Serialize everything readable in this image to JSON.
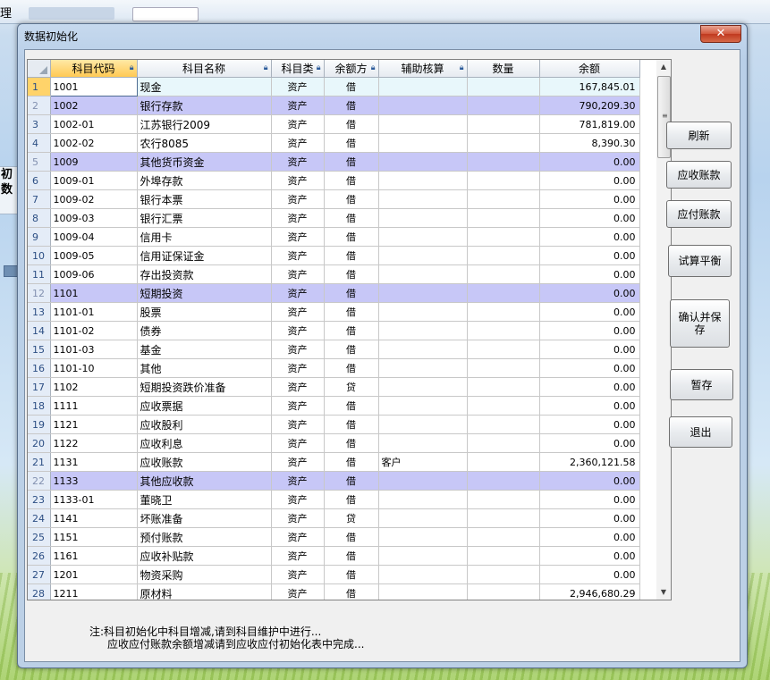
{
  "background": {
    "menu_label": "理",
    "side_label_1": "初",
    "side_label_2": "数"
  },
  "dialog": {
    "title": "数据初始化",
    "close_icon": "close-icon"
  },
  "grid": {
    "columns": [
      "科目代码",
      "科目名称",
      "科目类",
      "余额方",
      "辅助核算",
      "数量",
      "余额"
    ],
    "rows": [
      {
        "num": "1",
        "code": "1001",
        "name": "现金",
        "type": "资产",
        "dir": "借",
        "aux": "",
        "qty": "",
        "bal": "167,845.01",
        "hl": false
      },
      {
        "num": "2",
        "code": "1002",
        "name": "银行存款",
        "type": "资产",
        "dir": "借",
        "aux": "",
        "qty": "",
        "bal": "790,209.30",
        "hl": true
      },
      {
        "num": "3",
        "code": "1002-01",
        "name": "江苏银行2009",
        "type": "资产",
        "dir": "借",
        "aux": "",
        "qty": "",
        "bal": "781,819.00",
        "hl": false
      },
      {
        "num": "4",
        "code": "1002-02",
        "name": "农行8085",
        "type": "资产",
        "dir": "借",
        "aux": "",
        "qty": "",
        "bal": "8,390.30",
        "hl": false
      },
      {
        "num": "5",
        "code": "1009",
        "name": "其他货币资金",
        "type": "资产",
        "dir": "借",
        "aux": "",
        "qty": "",
        "bal": "0.00",
        "hl": true
      },
      {
        "num": "6",
        "code": "1009-01",
        "name": "外埠存款",
        "type": "资产",
        "dir": "借",
        "aux": "",
        "qty": "",
        "bal": "0.00",
        "hl": false
      },
      {
        "num": "7",
        "code": "1009-02",
        "name": "银行本票",
        "type": "资产",
        "dir": "借",
        "aux": "",
        "qty": "",
        "bal": "0.00",
        "hl": false
      },
      {
        "num": "8",
        "code": "1009-03",
        "name": "银行汇票",
        "type": "资产",
        "dir": "借",
        "aux": "",
        "qty": "",
        "bal": "0.00",
        "hl": false
      },
      {
        "num": "9",
        "code": "1009-04",
        "name": "信用卡",
        "type": "资产",
        "dir": "借",
        "aux": "",
        "qty": "",
        "bal": "0.00",
        "hl": false
      },
      {
        "num": "10",
        "code": "1009-05",
        "name": "信用证保证金",
        "type": "资产",
        "dir": "借",
        "aux": "",
        "qty": "",
        "bal": "0.00",
        "hl": false
      },
      {
        "num": "11",
        "code": "1009-06",
        "name": "存出投资款",
        "type": "资产",
        "dir": "借",
        "aux": "",
        "qty": "",
        "bal": "0.00",
        "hl": false
      },
      {
        "num": "12",
        "code": "1101",
        "name": "短期投资",
        "type": "资产",
        "dir": "借",
        "aux": "",
        "qty": "",
        "bal": "0.00",
        "hl": true
      },
      {
        "num": "13",
        "code": "1101-01",
        "name": "股票",
        "type": "资产",
        "dir": "借",
        "aux": "",
        "qty": "",
        "bal": "0.00",
        "hl": false
      },
      {
        "num": "14",
        "code": "1101-02",
        "name": "债券",
        "type": "资产",
        "dir": "借",
        "aux": "",
        "qty": "",
        "bal": "0.00",
        "hl": false
      },
      {
        "num": "15",
        "code": "1101-03",
        "name": "基金",
        "type": "资产",
        "dir": "借",
        "aux": "",
        "qty": "",
        "bal": "0.00",
        "hl": false
      },
      {
        "num": "16",
        "code": "1101-10",
        "name": "其他",
        "type": "资产",
        "dir": "借",
        "aux": "",
        "qty": "",
        "bal": "0.00",
        "hl": false
      },
      {
        "num": "17",
        "code": "1102",
        "name": "短期投资跌价准备",
        "type": "资产",
        "dir": "贷",
        "aux": "",
        "qty": "",
        "bal": "0.00",
        "hl": false
      },
      {
        "num": "18",
        "code": "1111",
        "name": "应收票据",
        "type": "资产",
        "dir": "借",
        "aux": "",
        "qty": "",
        "bal": "0.00",
        "hl": false
      },
      {
        "num": "19",
        "code": "1121",
        "name": "应收股利",
        "type": "资产",
        "dir": "借",
        "aux": "",
        "qty": "",
        "bal": "0.00",
        "hl": false
      },
      {
        "num": "20",
        "code": "1122",
        "name": "应收利息",
        "type": "资产",
        "dir": "借",
        "aux": "",
        "qty": "",
        "bal": "0.00",
        "hl": false
      },
      {
        "num": "21",
        "code": "1131",
        "name": "应收账款",
        "type": "资产",
        "dir": "借",
        "aux": "客户",
        "qty": "",
        "bal": "2,360,121.58",
        "hl": false
      },
      {
        "num": "22",
        "code": "1133",
        "name": "其他应收款",
        "type": "资产",
        "dir": "借",
        "aux": "",
        "qty": "",
        "bal": "0.00",
        "hl": true
      },
      {
        "num": "23",
        "code": "1133-01",
        "name": "董晓卫",
        "type": "资产",
        "dir": "借",
        "aux": "",
        "qty": "",
        "bal": "0.00",
        "hl": false
      },
      {
        "num": "24",
        "code": "1141",
        "name": "坏账准备",
        "type": "资产",
        "dir": "贷",
        "aux": "",
        "qty": "",
        "bal": "0.00",
        "hl": false
      },
      {
        "num": "25",
        "code": "1151",
        "name": "预付账款",
        "type": "资产",
        "dir": "借",
        "aux": "",
        "qty": "",
        "bal": "0.00",
        "hl": false
      },
      {
        "num": "26",
        "code": "1161",
        "name": "应收补贴款",
        "type": "资产",
        "dir": "借",
        "aux": "",
        "qty": "",
        "bal": "0.00",
        "hl": false
      },
      {
        "num": "27",
        "code": "1201",
        "name": "物资采购",
        "type": "资产",
        "dir": "借",
        "aux": "",
        "qty": "",
        "bal": "0.00",
        "hl": false
      },
      {
        "num": "28",
        "code": "1211",
        "name": "原材料",
        "type": "资产",
        "dir": "借",
        "aux": "",
        "qty": "",
        "bal": "2,946,680.29",
        "hl": false
      }
    ]
  },
  "buttons": {
    "refresh": "刷新",
    "receivable": "应收账款",
    "payable": "应付账款",
    "trial_balance": "试算平衡",
    "confirm_save": "确认并保存",
    "temp_save": "暂存",
    "exit": "退出"
  },
  "notes": {
    "line1": "注:科目初始化中科目增减,请到科目维护中进行...",
    "line2": "应收应付账款余额增减请到应收应付初始化表中完成..."
  }
}
